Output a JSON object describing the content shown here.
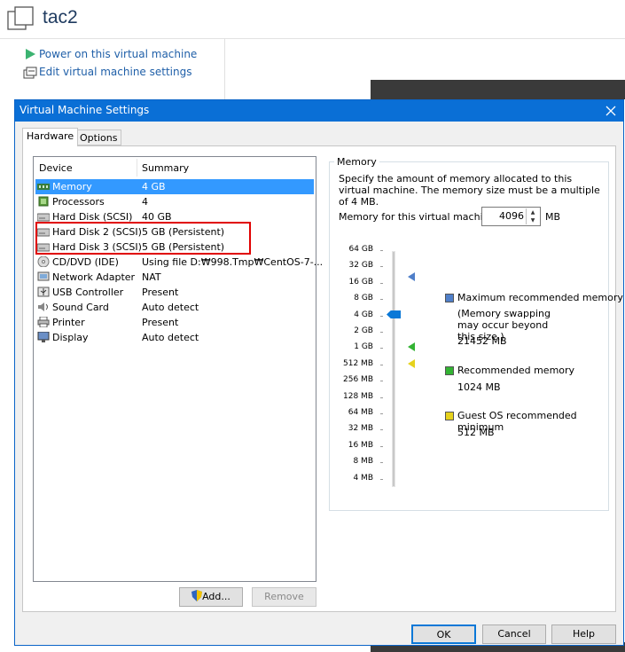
{
  "background": {
    "vm_title": "tac2",
    "actions": [
      "Power on this virtual machine",
      "Edit virtual machine settings"
    ]
  },
  "dialog": {
    "title": "Virtual Machine Settings",
    "tabs": [
      "Hardware",
      "Options"
    ],
    "columns": [
      "Device",
      "Summary"
    ],
    "devices": [
      {
        "name": "Memory",
        "summary": "4 GB",
        "icon": "memory-icon",
        "selected": true
      },
      {
        "name": "Processors",
        "summary": "4",
        "icon": "processor-icon"
      },
      {
        "name": "Hard Disk (SCSI)",
        "summary": "40 GB",
        "icon": "hard-disk-icon"
      },
      {
        "name": "Hard Disk 2 (SCSI)",
        "summary": "5 GB (Persistent)",
        "icon": "hard-disk-icon"
      },
      {
        "name": "Hard Disk 3 (SCSI)",
        "summary": "5 GB (Persistent)",
        "icon": "hard-disk-icon"
      },
      {
        "name": "CD/DVD (IDE)",
        "summary": "Using file D:₩998.Tmp₩CentOS-7-...",
        "icon": "cd-dvd-icon"
      },
      {
        "name": "Network Adapter",
        "summary": "NAT",
        "icon": "network-adapter-icon"
      },
      {
        "name": "USB Controller",
        "summary": "Present",
        "icon": "usb-icon"
      },
      {
        "name": "Sound Card",
        "summary": "Auto detect",
        "icon": "sound-card-icon"
      },
      {
        "name": "Printer",
        "summary": "Present",
        "icon": "printer-icon"
      },
      {
        "name": "Display",
        "summary": "Auto detect",
        "icon": "display-icon"
      }
    ],
    "buttons": {
      "add": "Add...",
      "remove": "Remove",
      "ok": "OK",
      "cancel": "Cancel",
      "help": "Help"
    },
    "memory": {
      "legend": "Memory",
      "description": "Specify the amount of memory allocated to this virtual machine. The memory size must be a multiple of 4 MB.",
      "field_label": "Memory for this virtual machine:",
      "value": "4096",
      "unit": "MB",
      "scale": [
        "64 GB",
        "32 GB",
        "16 GB",
        "8 GB",
        "4 GB",
        "2 GB",
        "1 GB",
        "512 MB",
        "256 MB",
        "128 MB",
        "64 MB",
        "32 MB",
        "16 MB",
        "8 MB",
        "4 MB"
      ],
      "current": "4 GB",
      "legend_items": [
        {
          "label": "Maximum recommended memory",
          "note": "(Memory swapping may occur beyond this size.)",
          "value": "21452 MB",
          "color": "#4f7fc9"
        },
        {
          "label": "Recommended memory",
          "note": "",
          "value": "1024 MB",
          "color": "#33b333"
        },
        {
          "label": "Guest OS recommended minimum",
          "note": "",
          "value": "512 MB",
          "color": "#e6d21c"
        }
      ]
    }
  }
}
